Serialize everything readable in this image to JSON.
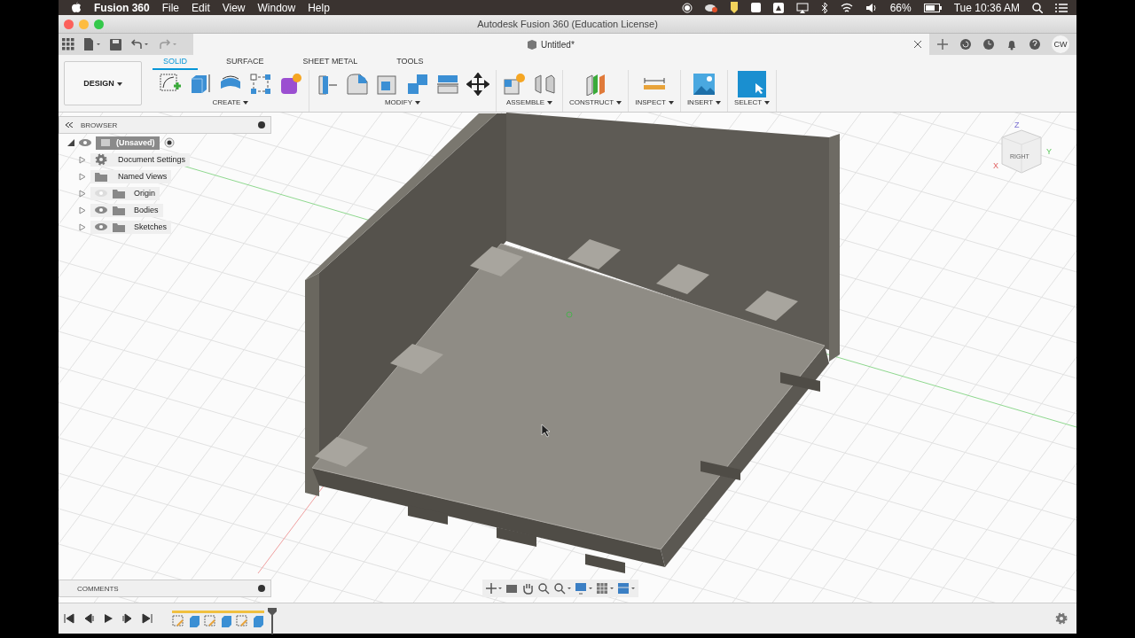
{
  "menu_bar": {
    "app_name": "Fusion 360",
    "menus": [
      "File",
      "Edit",
      "View",
      "Window",
      "Help"
    ],
    "battery": "66%",
    "clock": "Tue 10:36 AM"
  },
  "window": {
    "title": "Autodesk Fusion 360 (Education License)"
  },
  "document_tab": {
    "title": "Untitled*"
  },
  "user": {
    "initials": "CW"
  },
  "ribbon": {
    "workspace": "DESIGN",
    "tabs": [
      {
        "label": "SOLID",
        "selected": true
      },
      {
        "label": "SURFACE",
        "selected": false
      },
      {
        "label": "SHEET METAL",
        "selected": false
      },
      {
        "label": "TOOLS",
        "selected": false
      }
    ],
    "groups": [
      {
        "label": "CREATE",
        "tools": [
          {
            "kind": "sketch"
          },
          {
            "kind": "extrude"
          },
          {
            "kind": "revolve"
          },
          {
            "kind": "pattern"
          },
          {
            "kind": "form"
          }
        ]
      },
      {
        "label": "MODIFY",
        "tools": [
          {
            "kind": "presspull"
          },
          {
            "kind": "fillet"
          },
          {
            "kind": "shell"
          },
          {
            "kind": "combine"
          },
          {
            "kind": "split"
          },
          {
            "kind": "move"
          }
        ]
      },
      {
        "label": "ASSEMBLE",
        "tools": [
          {
            "kind": "component"
          },
          {
            "kind": "joint"
          }
        ]
      },
      {
        "label": "CONSTRUCT",
        "tools": [
          {
            "kind": "plane"
          }
        ]
      },
      {
        "label": "INSPECT",
        "tools": [
          {
            "kind": "measure"
          }
        ]
      },
      {
        "label": "INSERT",
        "tools": [
          {
            "kind": "image"
          }
        ]
      },
      {
        "label": "SELECT",
        "tools": [
          {
            "kind": "select"
          }
        ]
      }
    ]
  },
  "browser": {
    "title": "BROWSER",
    "root": {
      "label": "(Unsaved)",
      "expanded": true,
      "selected": true,
      "children": [
        {
          "label": "Document Settings",
          "kind": "settings",
          "selected": false
        },
        {
          "label": "Named Views",
          "kind": "views",
          "selected": false
        },
        {
          "label": "Origin",
          "kind": "layer",
          "visible": false,
          "selected": false
        },
        {
          "label": "Bodies",
          "kind": "layer",
          "visible": true,
          "selected": false
        },
        {
          "label": "Sketches",
          "kind": "layer",
          "visible": true,
          "selected": false
        }
      ]
    }
  },
  "view_cube": {
    "face": "RIGHT",
    "axes": [
      "Z",
      "Y",
      "X"
    ]
  },
  "comments": {
    "title": "COMMENTS"
  },
  "timeline": {
    "features": [
      {
        "kind": "sketch"
      },
      {
        "kind": "extrude"
      },
      {
        "kind": "sketch"
      },
      {
        "kind": "extrude"
      },
      {
        "kind": "sketch"
      },
      {
        "kind": "extrude"
      }
    ]
  }
}
